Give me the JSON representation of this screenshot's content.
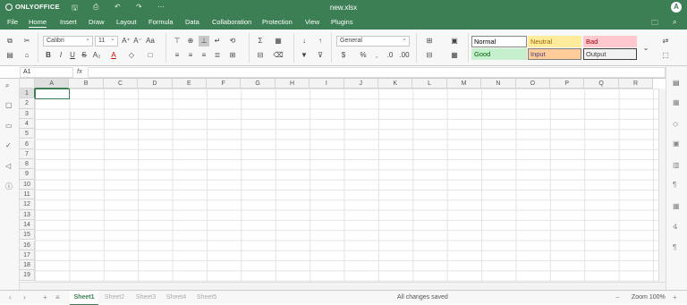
{
  "app": {
    "brand": "ONLYOFFICE",
    "doc_title": "new.xlsx",
    "avatar": "A"
  },
  "menu": {
    "tabs": [
      "File",
      "Home",
      "Insert",
      "Draw",
      "Layout",
      "Formula",
      "Data",
      "Collaboration",
      "Protection",
      "View",
      "Plugins"
    ],
    "active": "Home"
  },
  "toolbar": {
    "font": "Calibri",
    "size": "11",
    "number_format": "General",
    "styles": [
      "Normal",
      "Neutral",
      "Bad",
      "Good",
      "Input",
      "Output"
    ]
  },
  "formula": {
    "cell_ref": "A1",
    "fx": "fx",
    "value": ""
  },
  "grid": {
    "columns": [
      "A",
      "B",
      "C",
      "D",
      "E",
      "F",
      "G",
      "H",
      "I",
      "J",
      "K",
      "L",
      "M",
      "N",
      "O",
      "P",
      "Q",
      "R"
    ],
    "rows": [
      "1",
      "2",
      "3",
      "4",
      "5",
      "6",
      "7",
      "8",
      "9",
      "10",
      "11",
      "12",
      "13",
      "14",
      "15",
      "16",
      "17",
      "18",
      "19"
    ],
    "selected": "A1"
  },
  "sheets": {
    "tabs": [
      "Sheet1",
      "Sheet2",
      "Sheet3",
      "Sheet4",
      "Sheet5"
    ],
    "active": "Sheet1"
  },
  "status": {
    "message": "All changes saved",
    "zoom": "Zoom 100%"
  },
  "colors": {
    "brand": "#3d7f55",
    "neutral_bg": "#ffeb9c",
    "neutral_fg": "#9c6500",
    "bad_bg": "#ffc7ce",
    "bad_fg": "#9c0006",
    "good_bg": "#c6efce",
    "good_fg": "#006100",
    "input_bg": "#ffcc99",
    "input_fg": "#3f3f76"
  }
}
